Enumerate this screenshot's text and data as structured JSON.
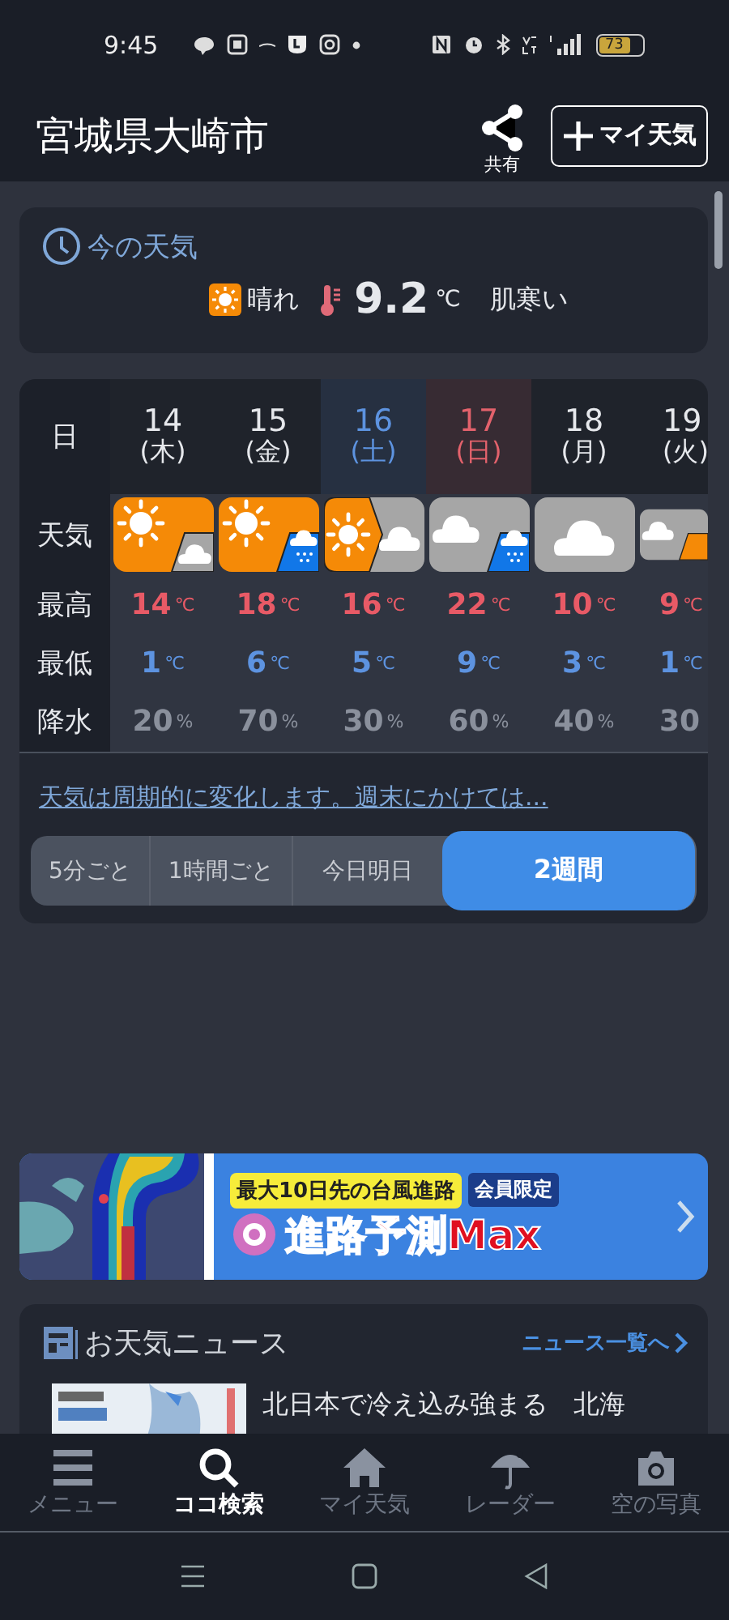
{
  "status_bar": {
    "time": "9:45",
    "battery": "73"
  },
  "header": {
    "title": "宮城県大崎市",
    "share_label": "共有",
    "my_weather_button": "マイ天気"
  },
  "current": {
    "title": "今の天気",
    "condition": "晴れ",
    "temperature": "9.2",
    "unit": "℃",
    "feel": "肌寒い"
  },
  "forecast": {
    "labels": {
      "date": "日",
      "weather": "天気",
      "high": "最高",
      "low": "最低",
      "precip": "降水"
    },
    "days": [
      {
        "day": "14",
        "weekday": "(木)",
        "color": "#e6e8ec",
        "kind": "suncloud",
        "high": "14",
        "high_unit": "℃",
        "low": "1",
        "low_unit": "℃",
        "precip": "20",
        "precip_unit": "%"
      },
      {
        "day": "15",
        "weekday": "(金)",
        "color": "#e6e8ec",
        "kind": "sunrain",
        "high": "18",
        "high_unit": "℃",
        "low": "6",
        "low_unit": "℃",
        "precip": "70",
        "precip_unit": "%"
      },
      {
        "day": "16",
        "weekday": "(土)",
        "color": "#5d93e0",
        "kind": "suncloudturn",
        "high": "16",
        "high_unit": "℃",
        "low": "5",
        "low_unit": "℃",
        "precip": "30",
        "precip_unit": "%"
      },
      {
        "day": "17",
        "weekday": "(日)",
        "color": "#e3626c",
        "kind": "cloudrain",
        "high": "22",
        "high_unit": "℃",
        "low": "9",
        "low_unit": "℃",
        "precip": "60",
        "precip_unit": "%"
      },
      {
        "day": "18",
        "weekday": "(月)",
        "color": "#e6e8ec",
        "kind": "cloud",
        "high": "10",
        "high_unit": "℃",
        "low": "3",
        "low_unit": "℃",
        "precip": "40",
        "precip_unit": "%"
      },
      {
        "day": "19",
        "weekday": "(火)",
        "color": "#e6e8ec",
        "kind": "cloudsun",
        "high": "9",
        "high_unit": "℃",
        "low": "1",
        "low_unit": "℃",
        "precip": "30"
      }
    ],
    "summary_link": "天気は周期的に変化します。週末にかけては...",
    "ranges": [
      {
        "label": "5分ごと",
        "selected": false
      },
      {
        "label": "1時間ごと",
        "selected": false
      },
      {
        "label": "今日明日",
        "selected": false
      },
      {
        "label": "2週間",
        "selected": true
      }
    ]
  },
  "banner": {
    "kind": "picture",
    "headline": "最大10日先の台風進路",
    "badge": "会員限定",
    "title": "進路予測Max"
  },
  "news": {
    "title": "お天気ニュース",
    "more_link": "ニュース一覧へ",
    "items": [
      {
        "kind": "picture",
        "headline": "北日本で冷え込み強まる　北海"
      }
    ]
  },
  "bottom_nav": [
    {
      "label": "メニュー",
      "selected": false
    },
    {
      "label": "ココ検索",
      "selected": true
    },
    {
      "label": "マイ天気",
      "selected": false
    },
    {
      "label": "レーダー",
      "selected": false
    },
    {
      "label": "空の写真",
      "selected": false
    }
  ]
}
